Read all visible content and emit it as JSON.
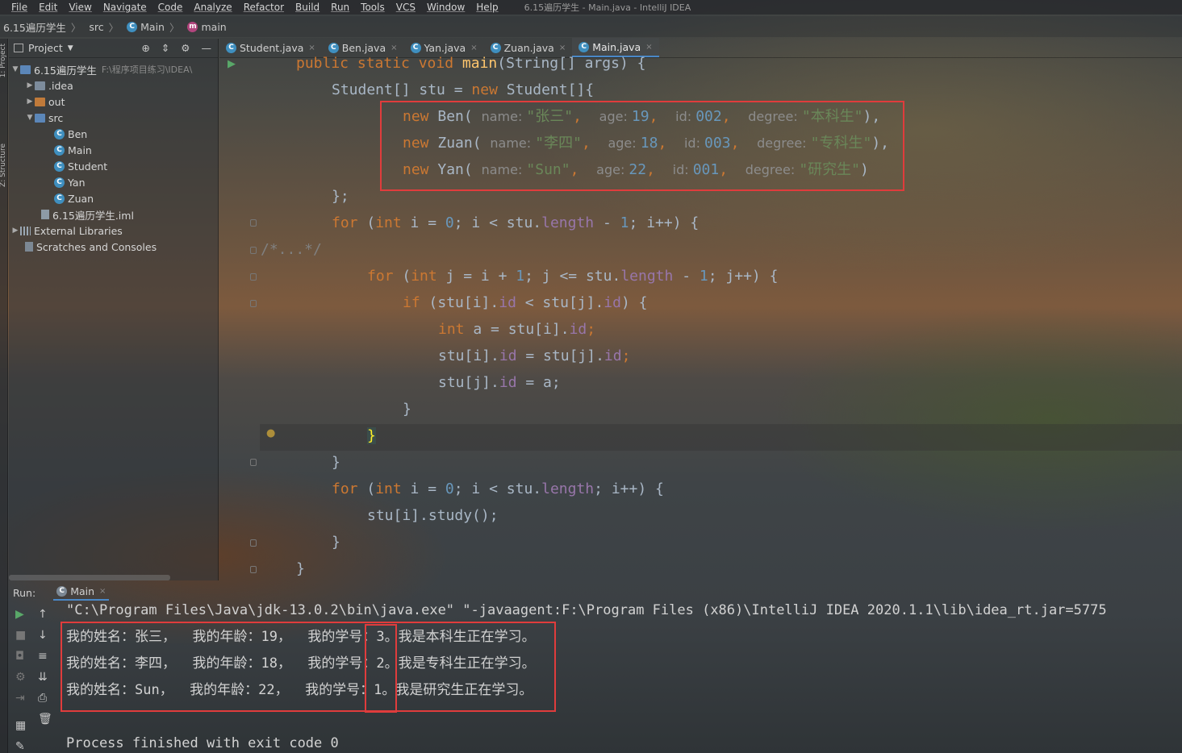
{
  "window_title": "6.15遍历学生 - Main.java - IntelliJ IDEA",
  "menu": [
    "File",
    "Edit",
    "View",
    "Navigate",
    "Code",
    "Analyze",
    "Refactor",
    "Build",
    "Run",
    "Tools",
    "VCS",
    "Window",
    "Help"
  ],
  "breadcrumb": {
    "project": "6.15遍历学生",
    "folder": "src",
    "class": "Main",
    "method": "main"
  },
  "project_panel": {
    "title": "Project",
    "root": "6.15遍历学生",
    "root_path": "F:\\程序项目练习\\IDEA\\",
    "items": [
      ".idea",
      "out",
      "src"
    ],
    "src_files": [
      "Ben",
      "Main",
      "Student",
      "Yan",
      "Zuan"
    ],
    "iml": "6.15遍历学生.iml",
    "external": "External Libraries",
    "scratches": "Scratches and Consoles",
    "side_labels": [
      "1: Project",
      "Z: Structure"
    ]
  },
  "tabs": [
    "Student.java",
    "Ben.java",
    "Yan.java",
    "Zuan.java",
    "Main.java"
  ],
  "active_tab": "Main.java",
  "code": {
    "l0": {
      "a": "public static void ",
      "b": "main",
      "c": "(String[] args) {"
    },
    "l1": "Student[] stu = ",
    "l1b": "new ",
    "l1c": "Student[]{",
    "objs": [
      {
        "cls": "Ben(",
        "name": "\"张三\"",
        "age": "19",
        "id": "002",
        "degree": "\"本科生\"",
        "end": "),"
      },
      {
        "cls": "Zuan(",
        "name": "\"李四\"",
        "age": "18",
        "id": "003",
        "degree": "\"专科生\"",
        "end": "),"
      },
      {
        "cls": "Yan(",
        "name": "\"Sun\"",
        "age": "22",
        "id": "001",
        "degree": "\"研究生\"",
        "end": ")"
      }
    ],
    "hint_name": "name: ",
    "hint_age": "age: ",
    "hint_id": "id: ",
    "hint_degree": "degree: ",
    "kw_new": "new ",
    "close_arr": "};",
    "for1": {
      "kw": "for",
      "a": " (",
      "int": "int",
      "b": " i = ",
      "zero": "0",
      "c": "; i < stu.",
      "len": "length",
      "d": " - ",
      "one": "1",
      "e": "; i++) {"
    },
    "fold": "/*...*/",
    "for2": {
      "kw": "for",
      "a": " (",
      "int": "int",
      "b": " j = i + ",
      "one": "1",
      "c": "; j <= stu.",
      "len": "length",
      "d": " - ",
      "one2": "1",
      "e": "; j++) {"
    },
    "if": {
      "kw": "if",
      "a": " (stu[i].",
      "id": "id",
      "b": " < stu[j].",
      "id2": "id",
      "c": ") {"
    },
    "assign1": {
      "int": "int",
      "a": " a = stu[i].",
      "id": "id",
      "b": ";"
    },
    "assign2": {
      "a": "stu[i].",
      "id": "id",
      "b": " = stu[j].",
      "id2": "id",
      "c": ";"
    },
    "assign3": {
      "a": "stu[j].",
      "id": "id",
      "b": " = a;"
    },
    "rbrace": "}",
    "for3": {
      "kw": "for",
      "a": " (",
      "int": "int",
      "b": " i = ",
      "zero": "0",
      "c": "; i < stu.",
      "len": "length",
      "d": "; i++) {"
    },
    "study": "stu[i].study();"
  },
  "run": {
    "label": "Run:",
    "tab": "Main",
    "cmd": "\"C:\\Program Files\\Java\\jdk-13.0.2\\bin\\java.exe\" \"-javaagent:F:\\Program Files (x86)\\IntelliJ IDEA 2020.1.1\\lib\\idea_rt.jar=5775",
    "out": [
      "我的姓名：张三，  我的年龄：19，  我的学号：3。我是本科生正在学习。",
      "我的姓名：李四，  我的年龄：18，  我的学号：2。我是专科生正在学习。",
      "我的姓名：Sun，  我的年龄：22，  我的学号：1。我是研究生正在学习。"
    ],
    "exit": "Process finished with exit code 0"
  },
  "colors": {
    "keyword": "#cc7832",
    "number": "#6897bb",
    "string": "#6a8759",
    "field": "#9876aa",
    "highlight_box": "#e03c3c"
  }
}
